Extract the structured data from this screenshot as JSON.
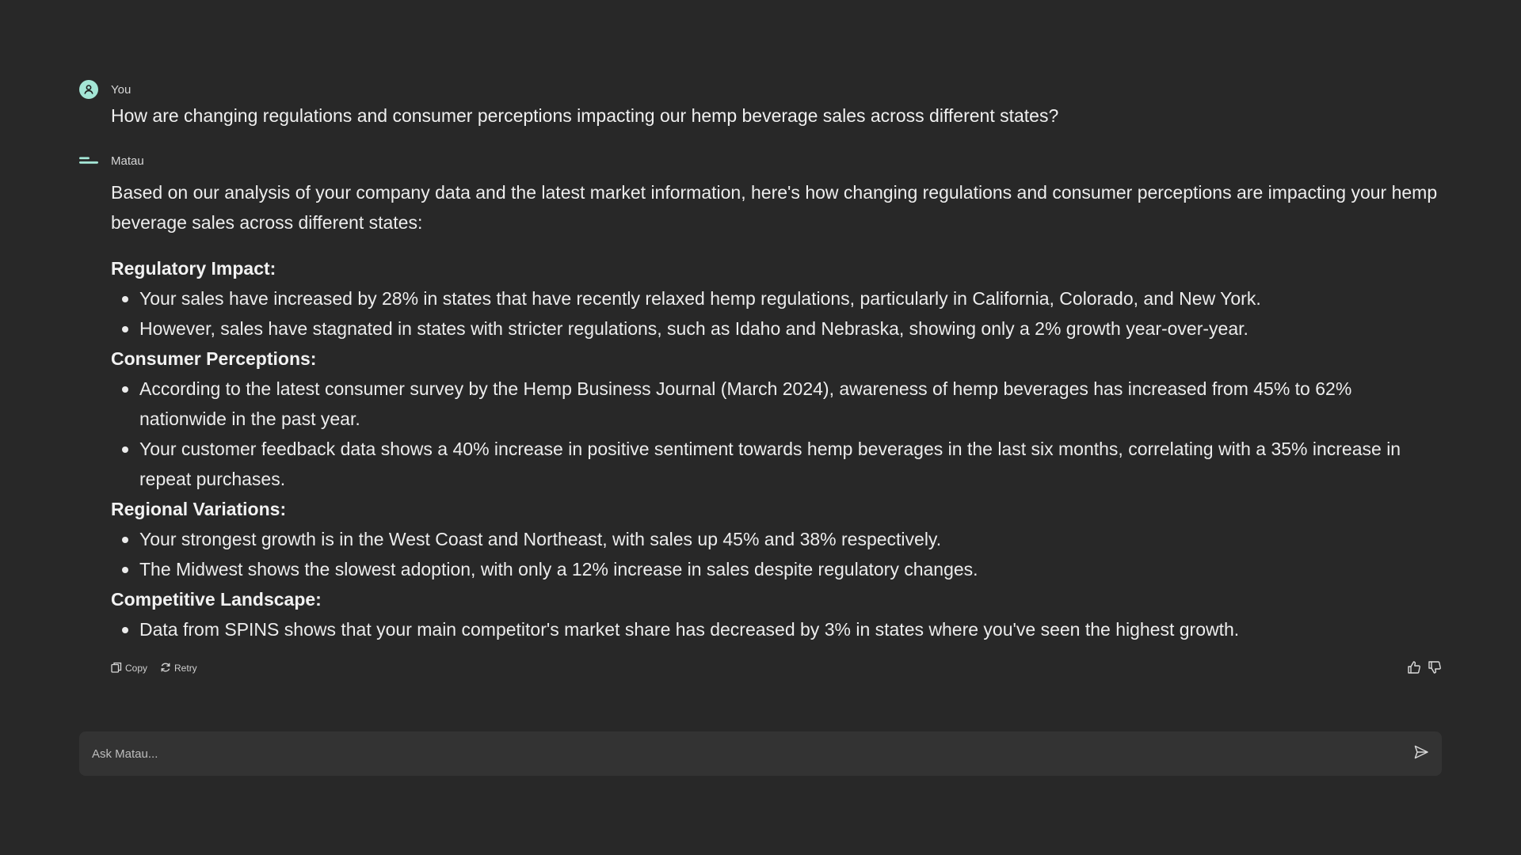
{
  "user_message": {
    "author": "You",
    "text": "How are changing regulations and consumer perceptions impacting our hemp beverage sales across different states?"
  },
  "assistant_message": {
    "author": "Matau",
    "intro": "Based on our analysis of your company data and the latest market information, here's how changing regulations and consumer perceptions are impacting your hemp beverage sales across different states:",
    "sections": [
      {
        "title": "Regulatory Impact:",
        "bullets": [
          "Your sales have increased by 28% in states that have recently relaxed hemp regulations, particularly in California, Colorado, and New York.",
          "However, sales have stagnated in states with stricter regulations, such as Idaho and Nebraska, showing only a 2% growth year-over-year."
        ]
      },
      {
        "title": "Consumer Perceptions:",
        "bullets": [
          "According to the latest consumer survey by the Hemp Business Journal (March 2024), awareness of hemp beverages has increased from 45% to 62% nationwide in the past year.",
          "Your customer feedback data shows a 40% increase in positive sentiment towards hemp beverages in the last six months, correlating with a 35% increase in repeat purchases."
        ]
      },
      {
        "title": "Regional Variations:",
        "bullets": [
          "Your strongest growth is in the West Coast and Northeast, with sales up 45% and 38% respectively.",
          "The Midwest shows the slowest adoption, with only a 12% increase in sales despite regulatory changes."
        ]
      },
      {
        "title": "Competitive Landscape:",
        "bullets": [
          "Data from SPINS shows that your main competitor's market share has decreased by 3% in states where you've seen the highest growth."
        ]
      }
    ],
    "actions": {
      "copy_label": "Copy",
      "retry_label": "Retry"
    }
  },
  "composer": {
    "placeholder": "Ask Matau..."
  },
  "icons": {
    "user_avatar": "user-avatar-icon",
    "bot_avatar": "matau-logo-icon",
    "copy": "copy-icon",
    "retry": "retry-icon",
    "thumbs_up": "thumbs-up-icon",
    "thumbs_down": "thumbs-down-icon",
    "send": "send-icon"
  },
  "colors": {
    "background": "#282828",
    "accent": "#a4e6d6",
    "composer_bg": "#333333"
  }
}
